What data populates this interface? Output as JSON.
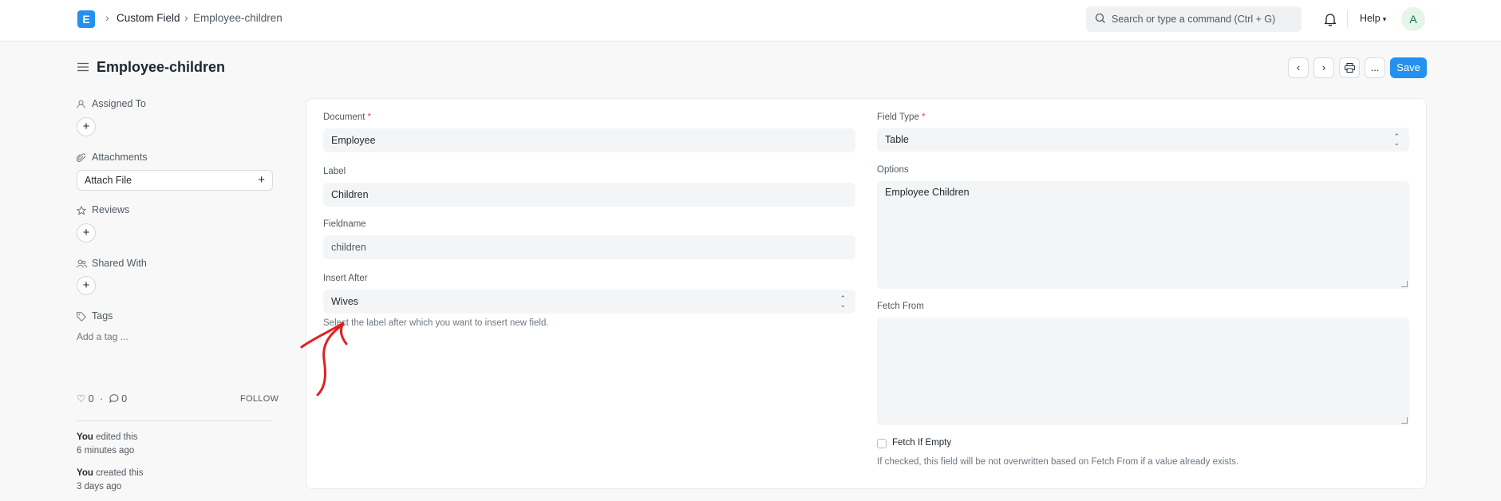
{
  "nav": {
    "logo": "E",
    "breadcrumbs": [
      "Custom Field",
      "Employee-children"
    ],
    "search_placeholder": "Search or type a command (Ctrl + G)",
    "help_label": "Help",
    "avatar_initial": "A"
  },
  "page": {
    "title": "Employee-children",
    "save_label": "Save",
    "more_label": "..."
  },
  "sidebar": {
    "assigned_to": "Assigned To",
    "attachments": "Attachments",
    "attach_file": "Attach File",
    "reviews": "Reviews",
    "shared_with": "Shared With",
    "tags": "Tags",
    "add_tag": "Add a tag ...",
    "likes_count": "0",
    "comments_count": "0",
    "follow": "FOLLOW",
    "activity": [
      {
        "who": "You",
        "action": "edited this",
        "when": "6 minutes ago"
      },
      {
        "who": "You",
        "action": "created this",
        "when": "3 days ago"
      }
    ]
  },
  "form": {
    "document": {
      "label": "Document",
      "value": "Employee"
    },
    "label": {
      "label": "Label",
      "value": "Children"
    },
    "fieldname": {
      "label": "Fieldname",
      "value": "children"
    },
    "insert_after": {
      "label": "Insert After",
      "value": "Wives",
      "hint": "Select the label after which you want to insert new field."
    },
    "field_type": {
      "label": "Field Type",
      "value": "Table"
    },
    "options": {
      "label": "Options",
      "value": "Employee Children"
    },
    "fetch_from": {
      "label": "Fetch From",
      "value": ""
    },
    "fetch_if_empty": {
      "label": "Fetch If Empty",
      "checked": false,
      "hint": "If checked, this field will be not overwritten based on Fetch From if a value already exists."
    }
  },
  "colors": {
    "primary": "#2490ef",
    "annotation": "#e02020",
    "required": "#e24c4c"
  }
}
